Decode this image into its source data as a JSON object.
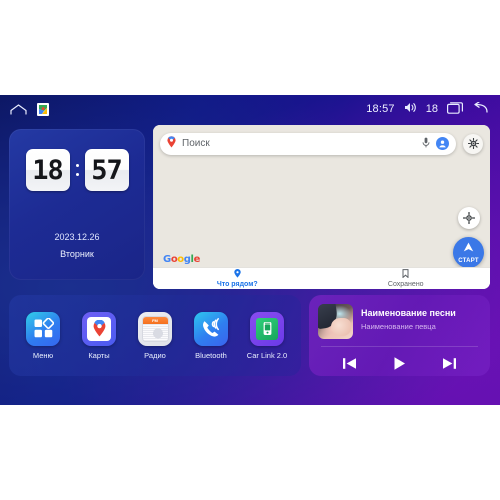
{
  "statusbar": {
    "home_icon": "home-icon",
    "maps_notification_icon": "google-maps-notification-icon",
    "time": "18:57",
    "volume_icon": "volume-icon",
    "battery_level": "18",
    "recents_icon": "recent-apps-icon",
    "back_icon": "back-icon"
  },
  "clock_widget": {
    "hours": "18",
    "minutes": "57",
    "date": "2023.12.26",
    "weekday": "Вторник"
  },
  "maps_card": {
    "search": {
      "placeholder": "Поиск",
      "pin_icon": "map-pin-icon",
      "mic_icon": "microphone-icon",
      "avatar_icon": "account-avatar-icon"
    },
    "layers_button_icon": "map-layers-icon",
    "locate_button_icon": "my-location-icon",
    "start_button": {
      "label": "СТАРТ",
      "icon": "navigation-arrow-icon",
      "color": "#3b78e7"
    },
    "google_logo": [
      "G",
      "o",
      "o",
      "g",
      "l",
      "e"
    ],
    "tabs": [
      {
        "label": "Что рядом?",
        "icon": "location-pin-icon",
        "active": true
      },
      {
        "label": "Сохранено",
        "icon": "bookmark-icon",
        "active": false
      }
    ],
    "active_tab_color": "#1a73e8"
  },
  "dock": {
    "apps": [
      {
        "label": "Меню",
        "icon": "apps-grid-icon"
      },
      {
        "label": "Карты",
        "icon": "google-maps-icon"
      },
      {
        "label": "Радио",
        "icon": "radio-icon",
        "band": "FM"
      },
      {
        "label": "Bluetooth",
        "icon": "bluetooth-phone-icon"
      },
      {
        "label": "Car Link 2.0",
        "icon": "car-link-icon"
      }
    ]
  },
  "music_widget": {
    "album_art_icon": "album-art-portrait",
    "track_title": "Наименование песни",
    "artist": "Наименование певца",
    "controls": [
      {
        "name": "previous-track",
        "icon": "skip-previous-icon"
      },
      {
        "name": "play",
        "icon": "play-icon"
      },
      {
        "name": "next-track",
        "icon": "skip-next-icon"
      }
    ]
  }
}
